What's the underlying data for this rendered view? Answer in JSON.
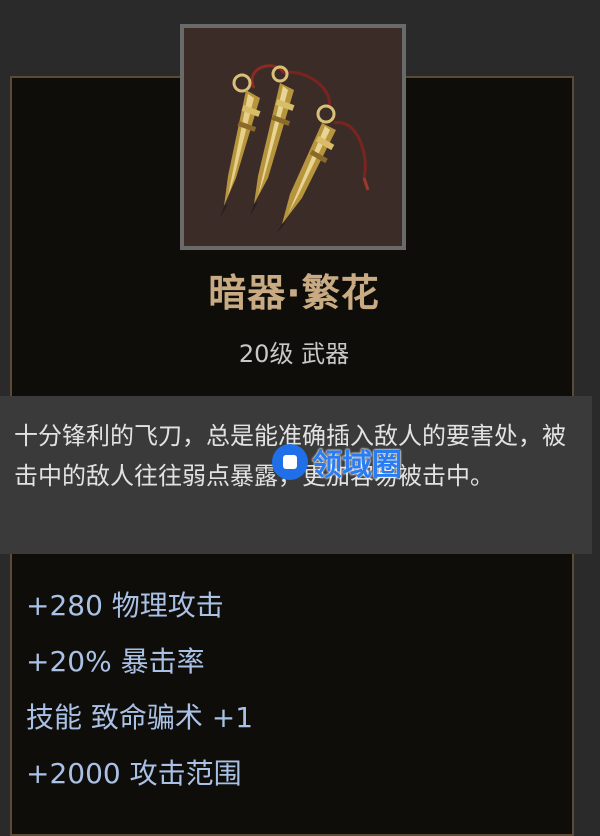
{
  "item": {
    "icon": "throwing-daggers-icon",
    "name": "暗器·繁花",
    "level_type": "20级 武器",
    "description": "十分锋利的飞刀，总是能准确插入敌人的要害处，被击中的敌人往往弱点暴露，更加容易被击中。",
    "stats": [
      "+280 物理攻击",
      "+20% 暴击率",
      "技能 致命骗术 +1",
      "+2000 攻击范围"
    ]
  },
  "watermark": {
    "icon": "watermark-logo-icon",
    "text": "领域圈"
  },
  "colors": {
    "name": "#c9ab83",
    "stat": "#a9c1e4",
    "panel": "#0f0d0a",
    "description_bg": "#3a3a3a"
  }
}
